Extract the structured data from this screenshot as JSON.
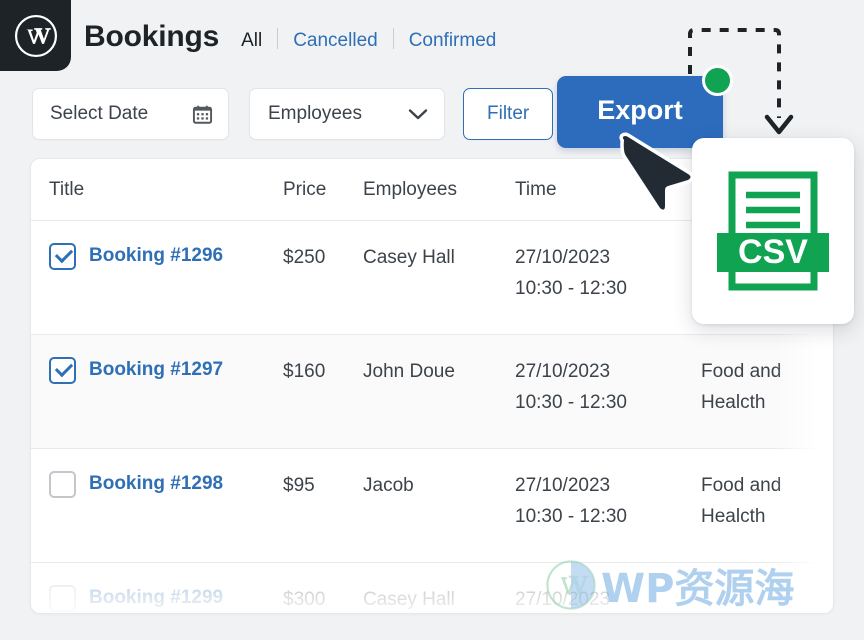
{
  "brand": {
    "logo_icon": "wordpress-logo-icon",
    "logo_bg": "#1d2327"
  },
  "header": {
    "title": "Bookings",
    "tabs": [
      {
        "label": "All",
        "active": true
      },
      {
        "label": "Cancelled",
        "active": false
      },
      {
        "label": "Confirmed",
        "active": false
      }
    ]
  },
  "toolbar": {
    "select_date": {
      "label": "Select Date",
      "icon": "calendar-icon"
    },
    "employees": {
      "label": "Employees",
      "icon": "chevron-down-icon"
    },
    "filter_label": "Filter",
    "export_label": "Export",
    "export_badge_color": "#0fa352"
  },
  "annotation": {
    "arrow": "dashed-arrow-down",
    "arrow_color": "#1d2327"
  },
  "table": {
    "columns": [
      "Title",
      "Price",
      "Employees",
      "Time",
      ""
    ],
    "rows": [
      {
        "checked": true,
        "title": "Booking #1296",
        "price": "$250",
        "employee": "Casey Hall",
        "time": "27/10/2023\n10:30 - 12:30",
        "extra": "",
        "faded": false
      },
      {
        "checked": true,
        "title": "Booking #1297",
        "price": "$160",
        "employee": "John Doue",
        "time": "27/10/2023\n10:30 - 12:30",
        "extra": "Food and\nHealcth",
        "faded": false
      },
      {
        "checked": false,
        "title": "Booking #1298",
        "price": "$95",
        "employee": "Jacob",
        "time": "27/10/2023\n10:30 - 12:30",
        "extra": "Food and\nHealcth",
        "faded": false
      },
      {
        "checked": false,
        "title": "Booking #1299",
        "price": "$300",
        "employee": "Casey Hall",
        "time": "27/10/2023",
        "extra": "",
        "faded": true
      }
    ]
  },
  "csv_popup": {
    "label": "CSV",
    "icon": "csv-file-icon",
    "color": "#0fa352"
  },
  "cursor": {
    "icon": "mouse-pointer-icon"
  },
  "watermark": {
    "text": "WP资源海",
    "logo_icon": "wordpress-logo-icon",
    "color": "#7fb4e4"
  },
  "colors": {
    "accent_blue": "#2f6fb5",
    "export_blue": "#2d6cbd",
    "green": "#0fa352",
    "page_bg": "#f1f2f3",
    "text": "#3c434a"
  }
}
